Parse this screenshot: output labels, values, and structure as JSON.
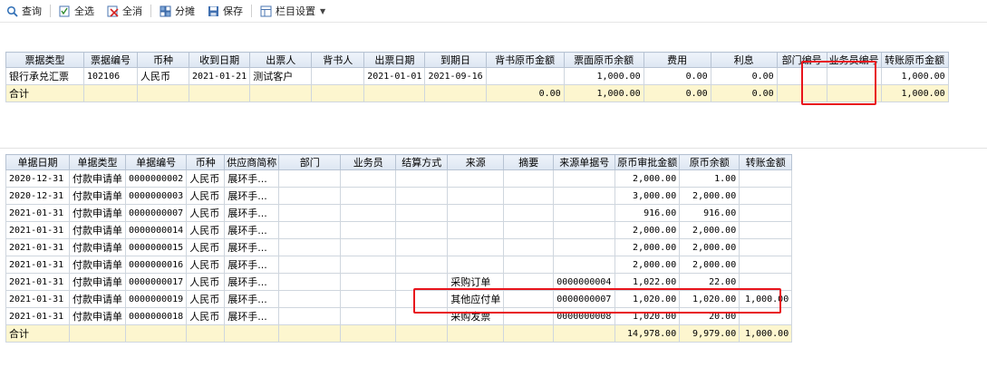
{
  "toolbar": {
    "query": "查询",
    "select_all": "全选",
    "deselect_all": "全消",
    "split": "分摊",
    "save": "保存",
    "columns": "栏目设置"
  },
  "top_table": {
    "headers": [
      "票据类型",
      "票据编号",
      "币种",
      "收到日期",
      "出票人",
      "背书人",
      "出票日期",
      "到期日",
      "背书原币金额",
      "票面原币余额",
      "费用",
      "利息",
      "部门编号",
      "业务员编号",
      "转账原币金额"
    ],
    "rows": [
      [
        "银行承兑汇票",
        "102106",
        "人民币",
        "2021-01-21",
        "测试客户",
        "",
        "2021-01-01",
        "2021-09-16",
        "",
        "1,000.00",
        "0.00",
        "0.00",
        "",
        "",
        "1,000.00"
      ]
    ],
    "total": [
      "合计",
      "",
      "",
      "",
      "",
      "",
      "",
      "",
      "0.00",
      "1,000.00",
      "0.00",
      "0.00",
      "",
      "",
      "1,000.00"
    ]
  },
  "bottom_table": {
    "headers": [
      "单据日期",
      "单据类型",
      "单据编号",
      "币种",
      "供应商简称",
      "部门",
      "业务员",
      "结算方式",
      "来源",
      "摘要",
      "来源单据号",
      "原币审批金额",
      "原币余额",
      "转账金额"
    ],
    "rows": [
      [
        "2020-12-31",
        "付款申请单",
        "0000000002",
        "人民币",
        "展环手...",
        "",
        "",
        "",
        "",
        "",
        "",
        "2,000.00",
        "1.00",
        ""
      ],
      [
        "2020-12-31",
        "付款申请单",
        "0000000003",
        "人民币",
        "展环手...",
        "",
        "",
        "",
        "",
        "",
        "",
        "3,000.00",
        "2,000.00",
        ""
      ],
      [
        "2021-01-31",
        "付款申请单",
        "0000000007",
        "人民币",
        "展环手...",
        "",
        "",
        "",
        "",
        "",
        "",
        "916.00",
        "916.00",
        ""
      ],
      [
        "2021-01-31",
        "付款申请单",
        "0000000014",
        "人民币",
        "展环手...",
        "",
        "",
        "",
        "",
        "",
        "",
        "2,000.00",
        "2,000.00",
        ""
      ],
      [
        "2021-01-31",
        "付款申请单",
        "0000000015",
        "人民币",
        "展环手...",
        "",
        "",
        "",
        "",
        "",
        "",
        "2,000.00",
        "2,000.00",
        ""
      ],
      [
        "2021-01-31",
        "付款申请单",
        "0000000016",
        "人民币",
        "展环手...",
        "",
        "",
        "",
        "",
        "",
        "",
        "2,000.00",
        "2,000.00",
        ""
      ],
      [
        "2021-01-31",
        "付款申请单",
        "0000000017",
        "人民币",
        "展环手...",
        "",
        "",
        "",
        "采购订单",
        "",
        "0000000004",
        "1,022.00",
        "22.00",
        ""
      ],
      [
        "2021-01-31",
        "付款申请单",
        "0000000019",
        "人民币",
        "展环手...",
        "",
        "",
        "",
        "其他应付单",
        "",
        "0000000007",
        "1,020.00",
        "1,020.00",
        "1,000.00"
      ],
      [
        "2021-01-31",
        "付款申请单",
        "0000000018",
        "人民币",
        "展环手...",
        "",
        "",
        "",
        "采购发票",
        "",
        "0000000008",
        "1,020.00",
        "20.00",
        ""
      ]
    ],
    "total": [
      "合计",
      "",
      "",
      "",
      "",
      "",
      "",
      "",
      "",
      "",
      "",
      "14,978.00",
      "9,979.00",
      "1,000.00"
    ]
  },
  "colors": {
    "highlight": "#e8141c",
    "total_row": "#fdf6cf",
    "header_bg": "#dde6f2",
    "selected_cell": "#3c5d96"
  },
  "icons": [
    "query-icon",
    "select-all-icon",
    "deselect-all-icon",
    "split-icon",
    "save-icon",
    "column-settings-icon",
    "dropdown-arrow-icon"
  ]
}
